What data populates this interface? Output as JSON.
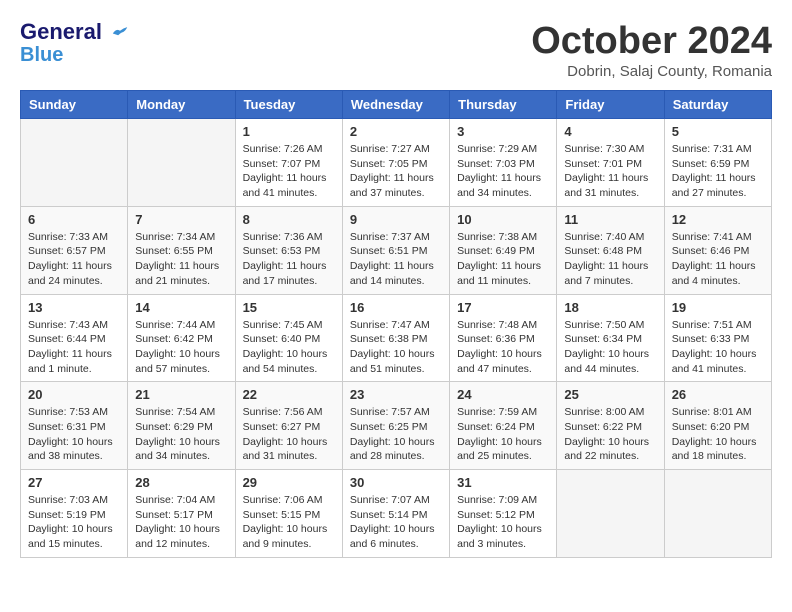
{
  "header": {
    "logo_line1": "General",
    "logo_line2": "Blue",
    "month": "October 2024",
    "location": "Dobrin, Salaj County, Romania"
  },
  "weekdays": [
    "Sunday",
    "Monday",
    "Tuesday",
    "Wednesday",
    "Thursday",
    "Friday",
    "Saturday"
  ],
  "weeks": [
    [
      {
        "day": "",
        "info": ""
      },
      {
        "day": "",
        "info": ""
      },
      {
        "day": "1",
        "info": "Sunrise: 7:26 AM\nSunset: 7:07 PM\nDaylight: 11 hours and 41 minutes."
      },
      {
        "day": "2",
        "info": "Sunrise: 7:27 AM\nSunset: 7:05 PM\nDaylight: 11 hours and 37 minutes."
      },
      {
        "day": "3",
        "info": "Sunrise: 7:29 AM\nSunset: 7:03 PM\nDaylight: 11 hours and 34 minutes."
      },
      {
        "day": "4",
        "info": "Sunrise: 7:30 AM\nSunset: 7:01 PM\nDaylight: 11 hours and 31 minutes."
      },
      {
        "day": "5",
        "info": "Sunrise: 7:31 AM\nSunset: 6:59 PM\nDaylight: 11 hours and 27 minutes."
      }
    ],
    [
      {
        "day": "6",
        "info": "Sunrise: 7:33 AM\nSunset: 6:57 PM\nDaylight: 11 hours and 24 minutes."
      },
      {
        "day": "7",
        "info": "Sunrise: 7:34 AM\nSunset: 6:55 PM\nDaylight: 11 hours and 21 minutes."
      },
      {
        "day": "8",
        "info": "Sunrise: 7:36 AM\nSunset: 6:53 PM\nDaylight: 11 hours and 17 minutes."
      },
      {
        "day": "9",
        "info": "Sunrise: 7:37 AM\nSunset: 6:51 PM\nDaylight: 11 hours and 14 minutes."
      },
      {
        "day": "10",
        "info": "Sunrise: 7:38 AM\nSunset: 6:49 PM\nDaylight: 11 hours and 11 minutes."
      },
      {
        "day": "11",
        "info": "Sunrise: 7:40 AM\nSunset: 6:48 PM\nDaylight: 11 hours and 7 minutes."
      },
      {
        "day": "12",
        "info": "Sunrise: 7:41 AM\nSunset: 6:46 PM\nDaylight: 11 hours and 4 minutes."
      }
    ],
    [
      {
        "day": "13",
        "info": "Sunrise: 7:43 AM\nSunset: 6:44 PM\nDaylight: 11 hours and 1 minute."
      },
      {
        "day": "14",
        "info": "Sunrise: 7:44 AM\nSunset: 6:42 PM\nDaylight: 10 hours and 57 minutes."
      },
      {
        "day": "15",
        "info": "Sunrise: 7:45 AM\nSunset: 6:40 PM\nDaylight: 10 hours and 54 minutes."
      },
      {
        "day": "16",
        "info": "Sunrise: 7:47 AM\nSunset: 6:38 PM\nDaylight: 10 hours and 51 minutes."
      },
      {
        "day": "17",
        "info": "Sunrise: 7:48 AM\nSunset: 6:36 PM\nDaylight: 10 hours and 47 minutes."
      },
      {
        "day": "18",
        "info": "Sunrise: 7:50 AM\nSunset: 6:34 PM\nDaylight: 10 hours and 44 minutes."
      },
      {
        "day": "19",
        "info": "Sunrise: 7:51 AM\nSunset: 6:33 PM\nDaylight: 10 hours and 41 minutes."
      }
    ],
    [
      {
        "day": "20",
        "info": "Sunrise: 7:53 AM\nSunset: 6:31 PM\nDaylight: 10 hours and 38 minutes."
      },
      {
        "day": "21",
        "info": "Sunrise: 7:54 AM\nSunset: 6:29 PM\nDaylight: 10 hours and 34 minutes."
      },
      {
        "day": "22",
        "info": "Sunrise: 7:56 AM\nSunset: 6:27 PM\nDaylight: 10 hours and 31 minutes."
      },
      {
        "day": "23",
        "info": "Sunrise: 7:57 AM\nSunset: 6:25 PM\nDaylight: 10 hours and 28 minutes."
      },
      {
        "day": "24",
        "info": "Sunrise: 7:59 AM\nSunset: 6:24 PM\nDaylight: 10 hours and 25 minutes."
      },
      {
        "day": "25",
        "info": "Sunrise: 8:00 AM\nSunset: 6:22 PM\nDaylight: 10 hours and 22 minutes."
      },
      {
        "day": "26",
        "info": "Sunrise: 8:01 AM\nSunset: 6:20 PM\nDaylight: 10 hours and 18 minutes."
      }
    ],
    [
      {
        "day": "27",
        "info": "Sunrise: 7:03 AM\nSunset: 5:19 PM\nDaylight: 10 hours and 15 minutes."
      },
      {
        "day": "28",
        "info": "Sunrise: 7:04 AM\nSunset: 5:17 PM\nDaylight: 10 hours and 12 minutes."
      },
      {
        "day": "29",
        "info": "Sunrise: 7:06 AM\nSunset: 5:15 PM\nDaylight: 10 hours and 9 minutes."
      },
      {
        "day": "30",
        "info": "Sunrise: 7:07 AM\nSunset: 5:14 PM\nDaylight: 10 hours and 6 minutes."
      },
      {
        "day": "31",
        "info": "Sunrise: 7:09 AM\nSunset: 5:12 PM\nDaylight: 10 hours and 3 minutes."
      },
      {
        "day": "",
        "info": ""
      },
      {
        "day": "",
        "info": ""
      }
    ]
  ]
}
